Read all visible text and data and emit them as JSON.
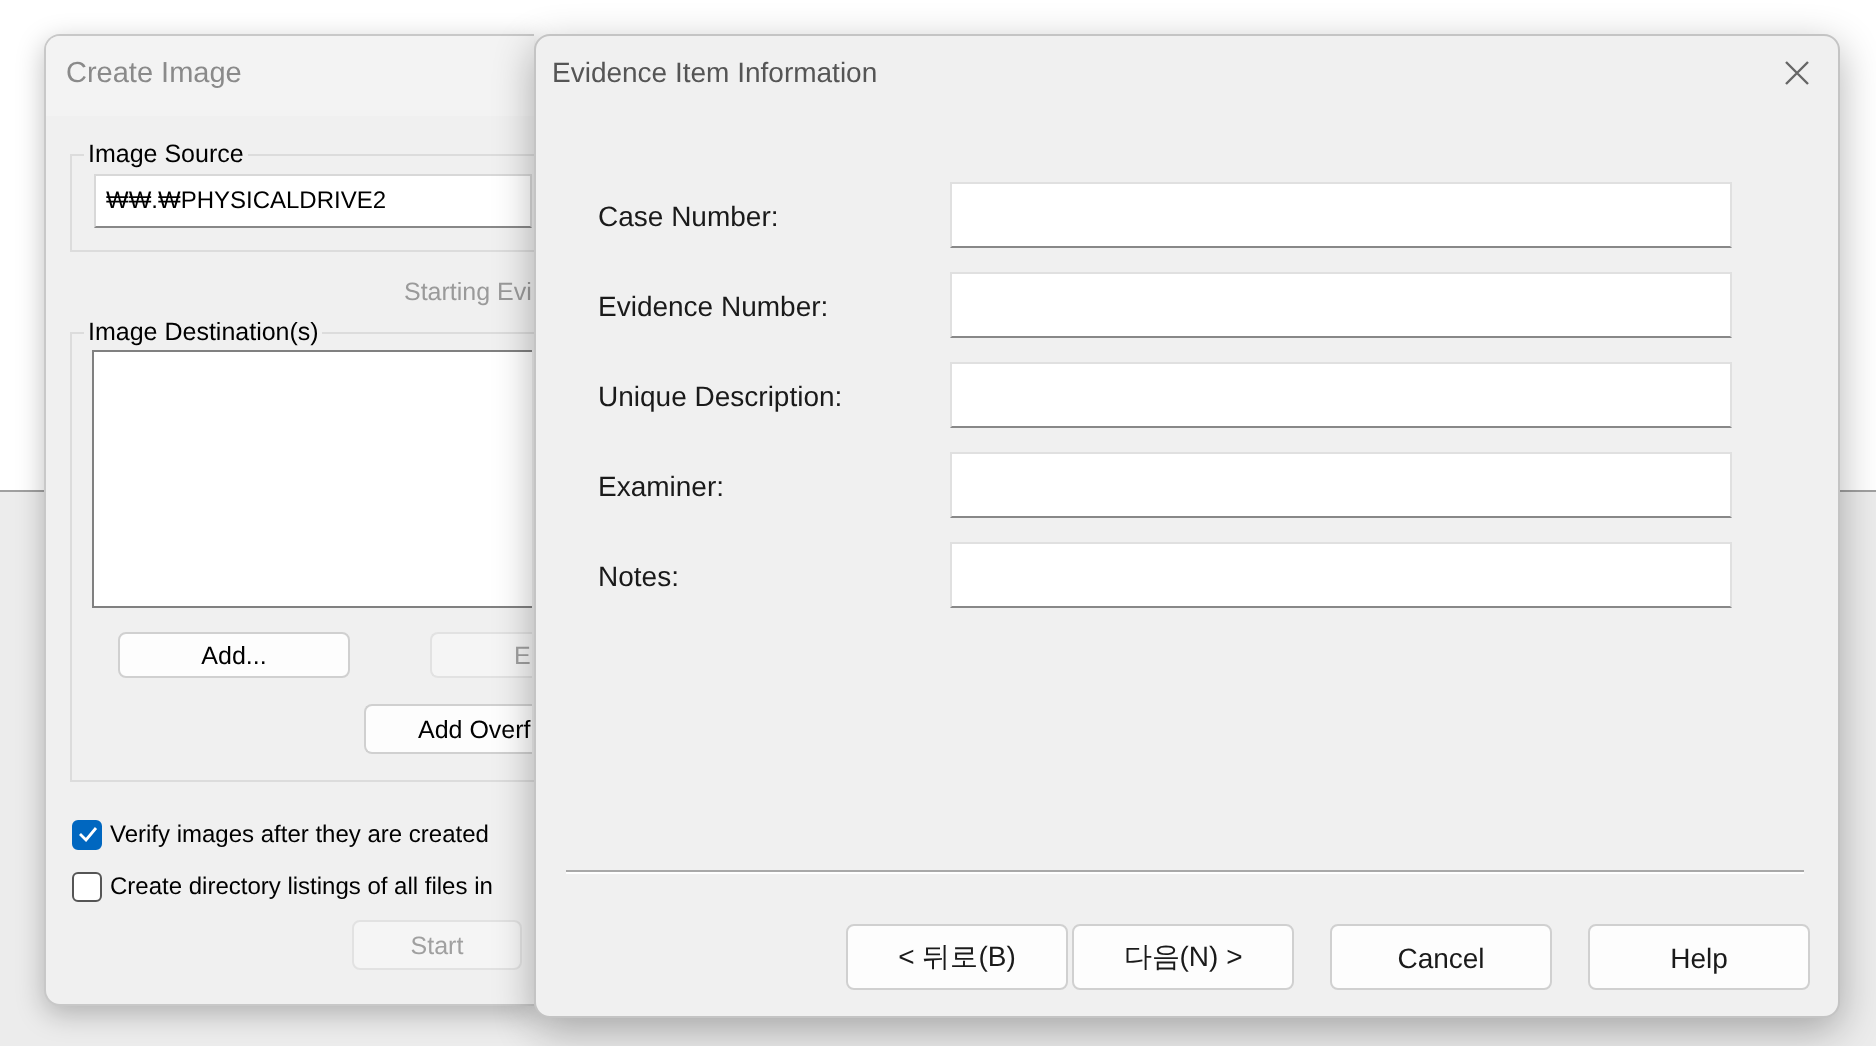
{
  "create_image": {
    "title": "Create Image",
    "source_group": "Image Source",
    "source_value": "₩₩.₩PHYSICALDRIVE2",
    "status": "Starting Evi",
    "dest_group": "Image Destination(s)",
    "buttons": [
      {
        "label": "Add...",
        "disabled": false
      },
      {
        "label": "E",
        "disabled": true
      },
      {
        "label": "Add Overf",
        "disabled": false
      }
    ],
    "options": [
      {
        "label": "Verify images after they are created",
        "checked": true
      },
      {
        "label": "Create directory listings of all files in",
        "checked": false
      }
    ],
    "start": {
      "label": "Start",
      "disabled": true
    }
  },
  "dialog": {
    "title": "Evidence Item Information",
    "fields": [
      {
        "label": "Case Number:"
      },
      {
        "label": "Evidence Number:"
      },
      {
        "label": "Unique Description:"
      },
      {
        "label": "Examiner:"
      },
      {
        "label": "Notes:"
      }
    ],
    "buttons": [
      "< 뒤로(B)",
      "다음(N) >",
      "Cancel",
      "Help"
    ]
  }
}
